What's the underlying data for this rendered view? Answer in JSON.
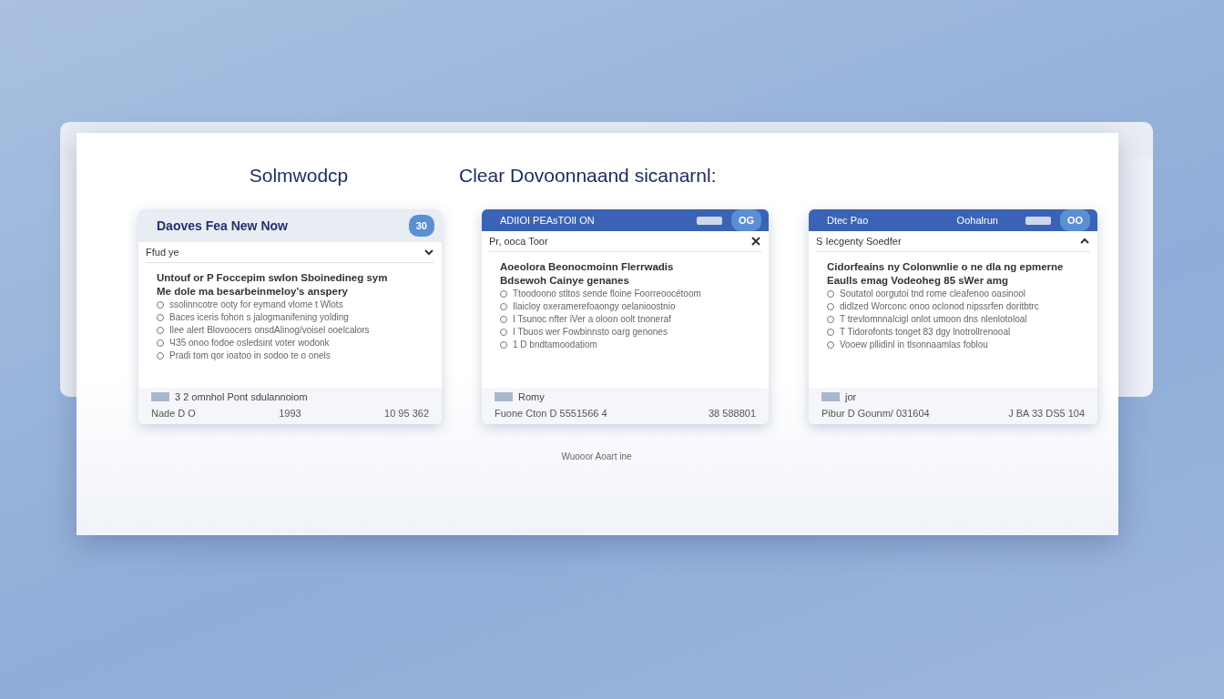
{
  "headings": [
    {
      "text": "Solmwodcp",
      "kind": "left"
    },
    {
      "text": "Clear Dovoonnaand sicanarnl:",
      "kind": "wide"
    }
  ],
  "cards": [
    {
      "kind": "light",
      "title": "Daoves Fea New Now",
      "badge": "30",
      "field": {
        "text": "Ffud ye",
        "kind": "dropdown"
      },
      "lines": [
        {
          "kind": "heading",
          "text": "Untouf or P Foccepim swlon Sboinedineg sym"
        },
        {
          "kind": "heading",
          "text": "Me dole ma besarbeinmeloy's anspery"
        },
        {
          "kind": "option",
          "text": "ssolinncotre ooty for eymand vlome t Wlots"
        },
        {
          "kind": "option",
          "text": "Baces iceris fohon s jalogmanifening yolding"
        },
        {
          "kind": "option",
          "text": "Ilee alert Blovoocers onsdAlinog/voisel ooelcalors"
        },
        {
          "kind": "option",
          "text": "ЧЗ5 onoo fodoe osledsint voter wodonk"
        },
        {
          "kind": "option",
          "text": "Pradi tom qor ioatoo in sodoo te o onels"
        }
      ],
      "chip": "3 2 omnhol Pont sdulannoiom",
      "footer": [
        "Nade D O",
        "1993",
        "10 95 362"
      ]
    },
    {
      "kind": "blue",
      "title": "ADIIOI PEAsTOlI ON",
      "badge": "OG",
      "field": {
        "text": "Pr, ooca Toor",
        "kind": "clearable"
      },
      "lines": [
        {
          "kind": "heading",
          "text": "Aoeolora Beonocmoinn Flerrwadis"
        },
        {
          "kind": "heading",
          "text": "Bdsewoh Cainye genanes"
        },
        {
          "kind": "option",
          "text": "Ttoodoono stltos sende floine Foorreoocétoom"
        },
        {
          "kind": "option",
          "text": "Ilaicloy oxeramerefoaongy oelanioostnio"
        },
        {
          "kind": "option",
          "text": "I Tsunoc nfter iVer a oloon oolt tnoneraf"
        },
        {
          "kind": "option",
          "text": "I Tbuos wer Fowbinnsto oarg genones"
        },
        {
          "kind": "option",
          "text": "1 D bndtamoodatiom"
        }
      ],
      "chip": "Romy",
      "footer": [
        "Fuone Cton D 5551566 4",
        "38 588801"
      ]
    },
    {
      "kind": "blue",
      "title": "Dtec Pao",
      "subtitle": "Oohalrun",
      "badge": "OO",
      "field": {
        "text": "S Iecgenty Soedfer",
        "kind": "collapsible"
      },
      "lines": [
        {
          "kind": "heading",
          "text": "Cidorfeains ny Colonwnlie o ne dla ng epmerne"
        },
        {
          "kind": "heading",
          "text": "Eaulls emag Vodeoheg 85 sWer amg"
        },
        {
          "kind": "option",
          "text": "Soutatol oorgutoi tnd rome cleafenoo oasinool"
        },
        {
          "kind": "option",
          "text": "didlzed Worconc onoo oclonod nipssrfen doritbtrc"
        },
        {
          "kind": "option",
          "text": "T trevlomnnalcigl onlot umoon dns nlenlotoloal"
        },
        {
          "kind": "option",
          "text": "T Tidorofonts tonget 83 dgy lnotrollrenooal"
        },
        {
          "kind": "option",
          "text": "Vooew pllidinl in tlsonnaamlas foblou"
        }
      ],
      "chip": "jor",
      "footer": [
        "Pibur D Gounm/ 031604",
        "J BA 33 DS5 104"
      ]
    }
  ],
  "caption": "Wuooor Aoart ine"
}
